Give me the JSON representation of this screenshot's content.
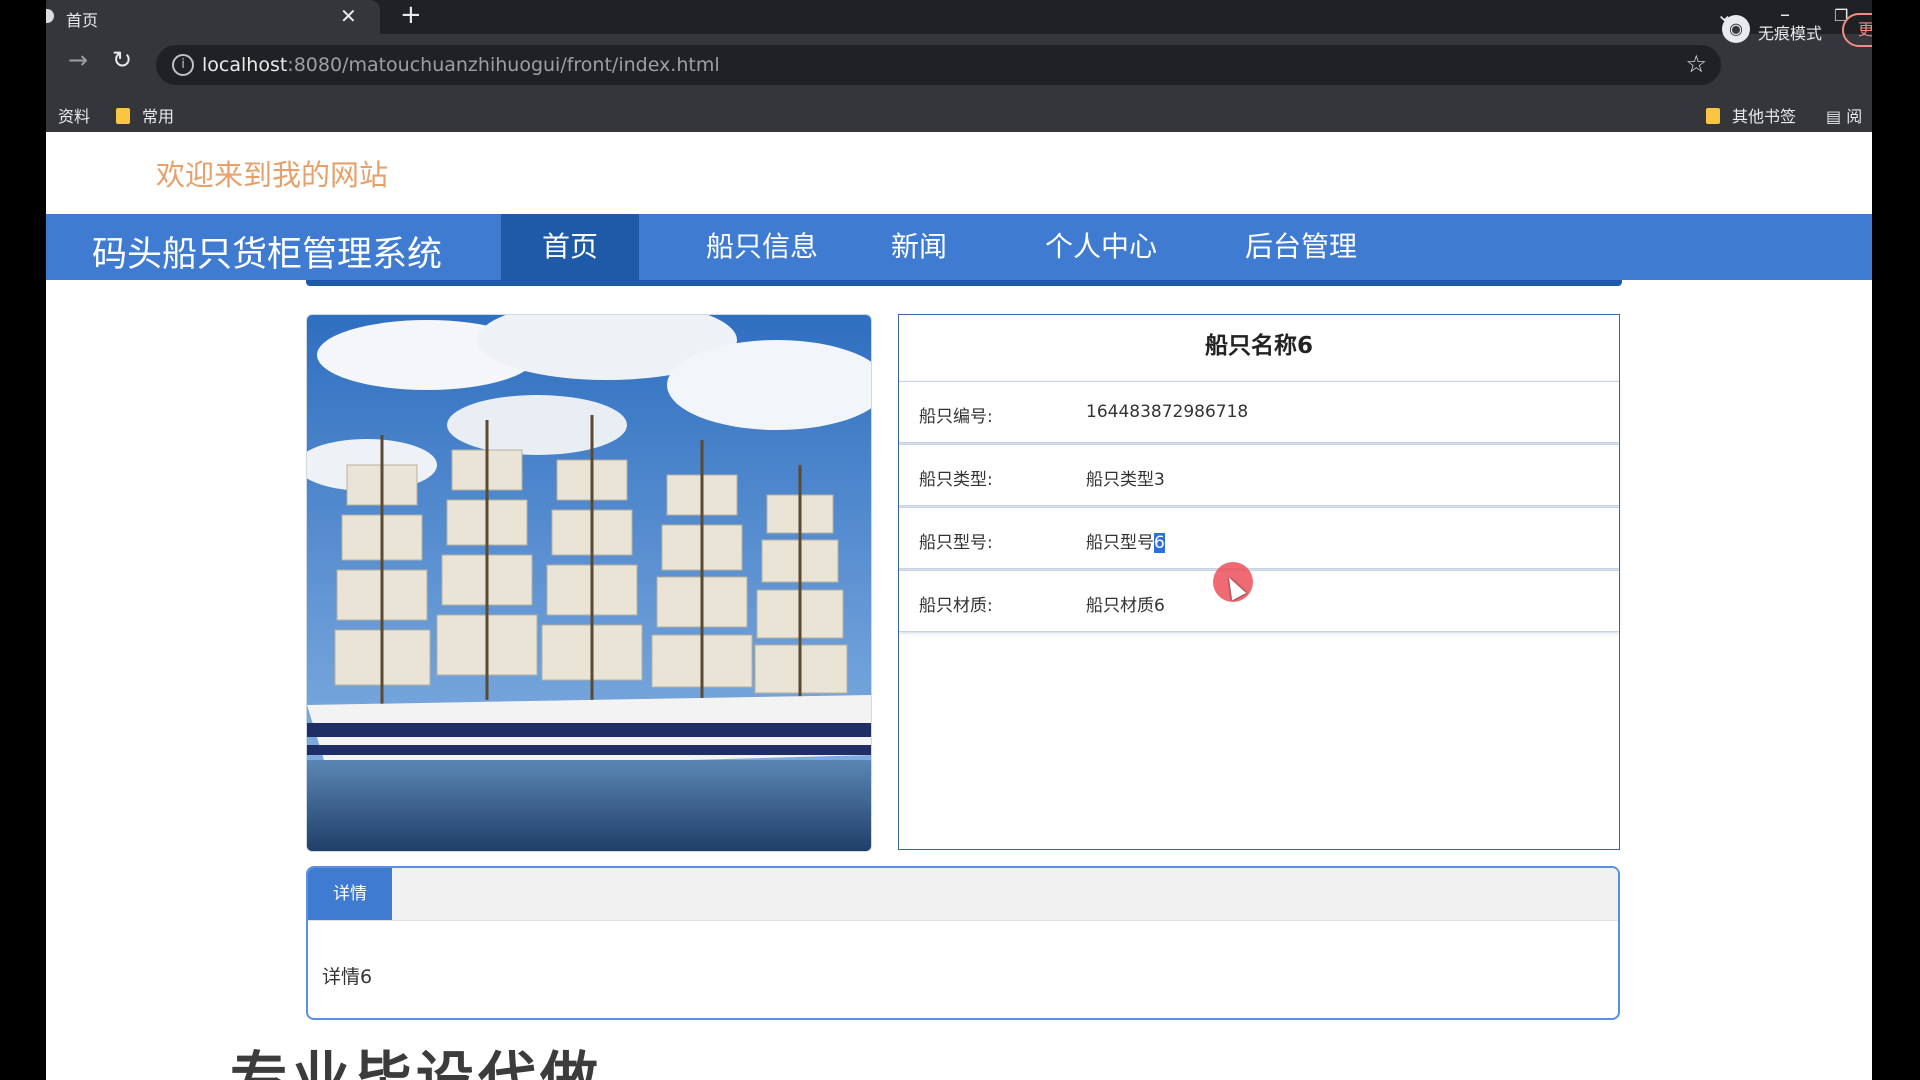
{
  "browser": {
    "tab_title": "首页",
    "url_host": "localhost",
    "url_rest": ":8080/matouchuanzhihuogui/front/index.html",
    "incognito_label": "无痕模式",
    "update_label": "更",
    "bookmarks": [
      "资料",
      "常用"
    ],
    "other_bookmarks": "其他书签",
    "reading_list": "阅"
  },
  "site": {
    "welcome": "欢迎来到我的网站",
    "brand": "码头船只货柜管理系统",
    "nav": [
      {
        "label": "首页",
        "active": true
      },
      {
        "label": "船只信息"
      },
      {
        "label": "新闻"
      },
      {
        "label": "个人中心"
      },
      {
        "label": "后台管理"
      }
    ]
  },
  "ship": {
    "name": "船只名称6",
    "fields": [
      {
        "label": "船只编号:",
        "value": "164483872986718"
      },
      {
        "label": "船只类型:",
        "value": "船只类型3"
      },
      {
        "label": "船只型号:",
        "value": "船只型号",
        "value_selected": "6"
      },
      {
        "label": "船只材质:",
        "value": "船只材质6"
      }
    ]
  },
  "detail": {
    "tab_label": "详情",
    "content": "详情6"
  },
  "overlay_text": "专业毕设代做",
  "colors": {
    "nav_bg": "#3e7bd1",
    "nav_active": "#1e5aa8",
    "welcome": "#e8a06a"
  }
}
